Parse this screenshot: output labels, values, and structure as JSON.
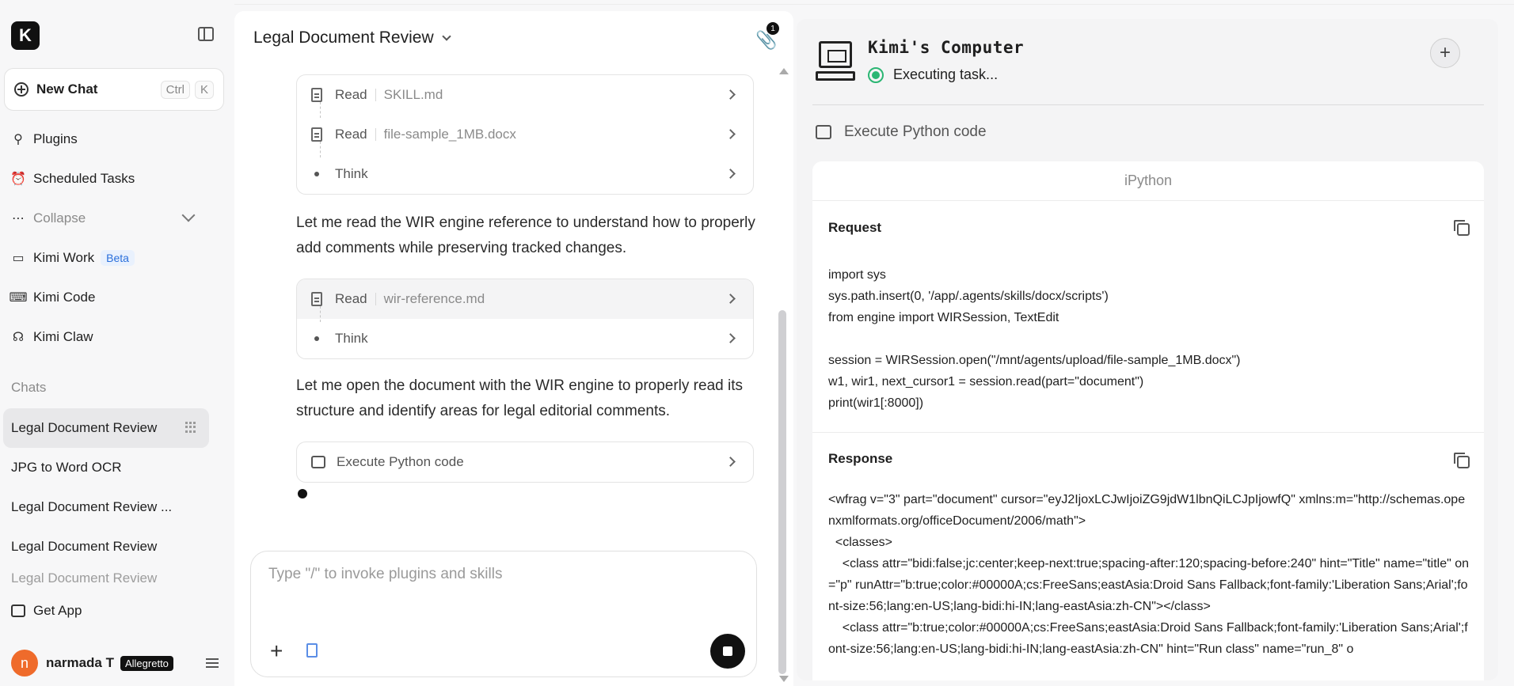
{
  "sidebar": {
    "logo_letter": "K",
    "new_chat_label": "New Chat",
    "shortcut_keys": [
      "Ctrl",
      "K"
    ],
    "nav": [
      {
        "label": "Plugins",
        "icon": "plug-icon"
      },
      {
        "label": "Scheduled Tasks",
        "icon": "alarm-clock-icon"
      },
      {
        "label": "Collapse",
        "icon": "ellipsis-icon"
      },
      {
        "label": "Kimi Work",
        "icon": "monitor-icon",
        "badge": "Beta"
      },
      {
        "label": "Kimi Code",
        "icon": "terminal-icon"
      },
      {
        "label": "Kimi Claw",
        "icon": "claw-icon"
      }
    ],
    "chats_title": "Chats",
    "chats": [
      "Legal Document Review",
      "JPG to Word OCR",
      "Legal Document Review ...",
      "Legal Document Review",
      "Legal Document Review"
    ],
    "get_app_label": "Get App",
    "user": {
      "initial": "n",
      "name": "narmada T",
      "plan": "Allegretto"
    }
  },
  "chat": {
    "title": "Legal Document Review",
    "attachment_count": "1",
    "card1": [
      {
        "action": "Read",
        "target": "SKILL.md"
      },
      {
        "action": "Read",
        "target": "file-sample_1MB.docx"
      },
      {
        "action": "Think"
      }
    ],
    "msg1": "Let me read the WIR engine reference to understand how to properly add comments while preserving tracked changes.",
    "card2": [
      {
        "action": "Read",
        "target": "wir-reference.md"
      },
      {
        "action": "Think"
      }
    ],
    "msg2": "Let me open the document with the WIR engine to properly read its structure and identify areas for legal editorial comments.",
    "card3": {
      "action": "Execute Python code"
    },
    "composer_placeholder": "Type \"/\" to invoke plugins and skills"
  },
  "computer": {
    "title": "Kimi's Computer",
    "status": "Executing task...",
    "step_label": "Execute Python code",
    "panel_header": "iPython",
    "request_title": "Request",
    "request_code": "import sys\nsys.path.insert(0, '/app/.agents/skills/docx/scripts')\nfrom engine import WIRSession, TextEdit\n\nsession = WIRSession.open(\"/mnt/agents/upload/file-sample_1MB.docx\")\nw1, wir1, next_cursor1 = session.read(part=\"document\")\nprint(wir1[:8000])",
    "response_title": "Response",
    "response_code": "<wfrag v=\"3\" part=\"document\" cursor=\"eyJ2IjoxLCJwIjoiZG9jdW1lbnQiLCJpIjowfQ\" xmlns:m=\"http://schemas.openxmlformats.org/officeDocument/2006/math\">\n  <classes>\n    <class attr=\"bidi:false;jc:center;keep-next:true;spacing-after:120;spacing-before:240\" hint=\"Title\" name=\"title\" on=\"p\" runAttr=\"b:true;color:#00000A;cs:FreeSans;eastAsia:Droid Sans Fallback;font-family:'Liberation Sans;Arial';font-size:56;lang:en-US;lang-bidi:hi-IN;lang-eastAsia:zh-CN\"></class>\n    <class attr=\"b:true;color:#00000A;cs:FreeSans;eastAsia:Droid Sans Fallback;font-family:'Liberation Sans;Arial';font-size:56;lang:en-US;lang-bidi:hi-IN;lang-eastAsia:zh-CN\" hint=\"Run class\" name=\"run_8\" o"
  }
}
